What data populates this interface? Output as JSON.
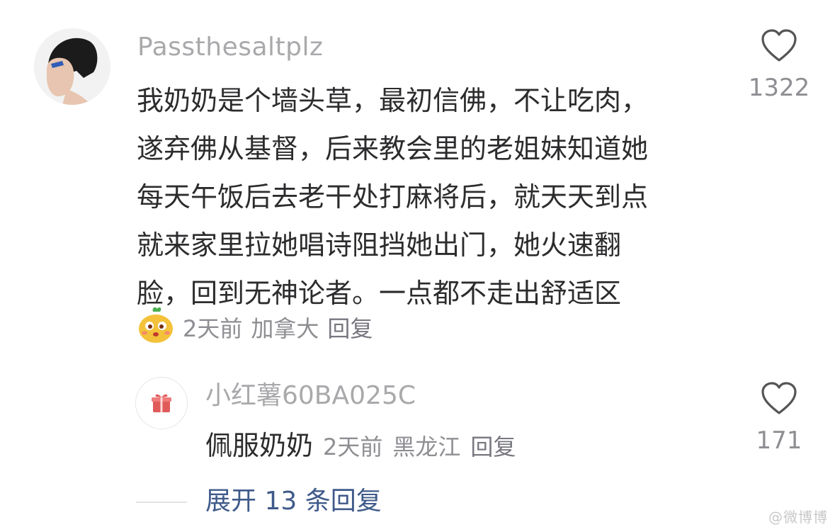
{
  "comment": {
    "username": "Passthesaltplz",
    "text": "我奶奶是个墙头草，最初信佛，不让吃肉，\n遂弃佛从基督，后来教会里的老姐妹知道她\n每天午饭后去老干处打麻将后，就天天到点\n就来家里拉她唱诗阻挡她出门，她火速翻\n脸，回到无神论者。一点都不走出舒适区",
    "time": "2天前",
    "location": "加拿大",
    "reply_label": "回复",
    "like_count": "1322",
    "like_icon": "heart-outline-icon",
    "sticker_icon": "cartoon-character-sticker"
  },
  "sub_reply": {
    "username": "小红薯60BA025C",
    "avatar_icon": "gift-box-icon",
    "text": "佩服奶奶",
    "time": "2天前",
    "location": "黑龙江",
    "reply_label": "回复",
    "like_count": "171",
    "like_icon": "heart-outline-icon"
  },
  "expand_replies_label": "展开 13 条回复",
  "watermark": "@微博博",
  "colors": {
    "text_primary": "#2c2c2e",
    "text_secondary": "#8e8e93",
    "username": "#a9a9ac",
    "expand_link": "#3f5a8a"
  }
}
